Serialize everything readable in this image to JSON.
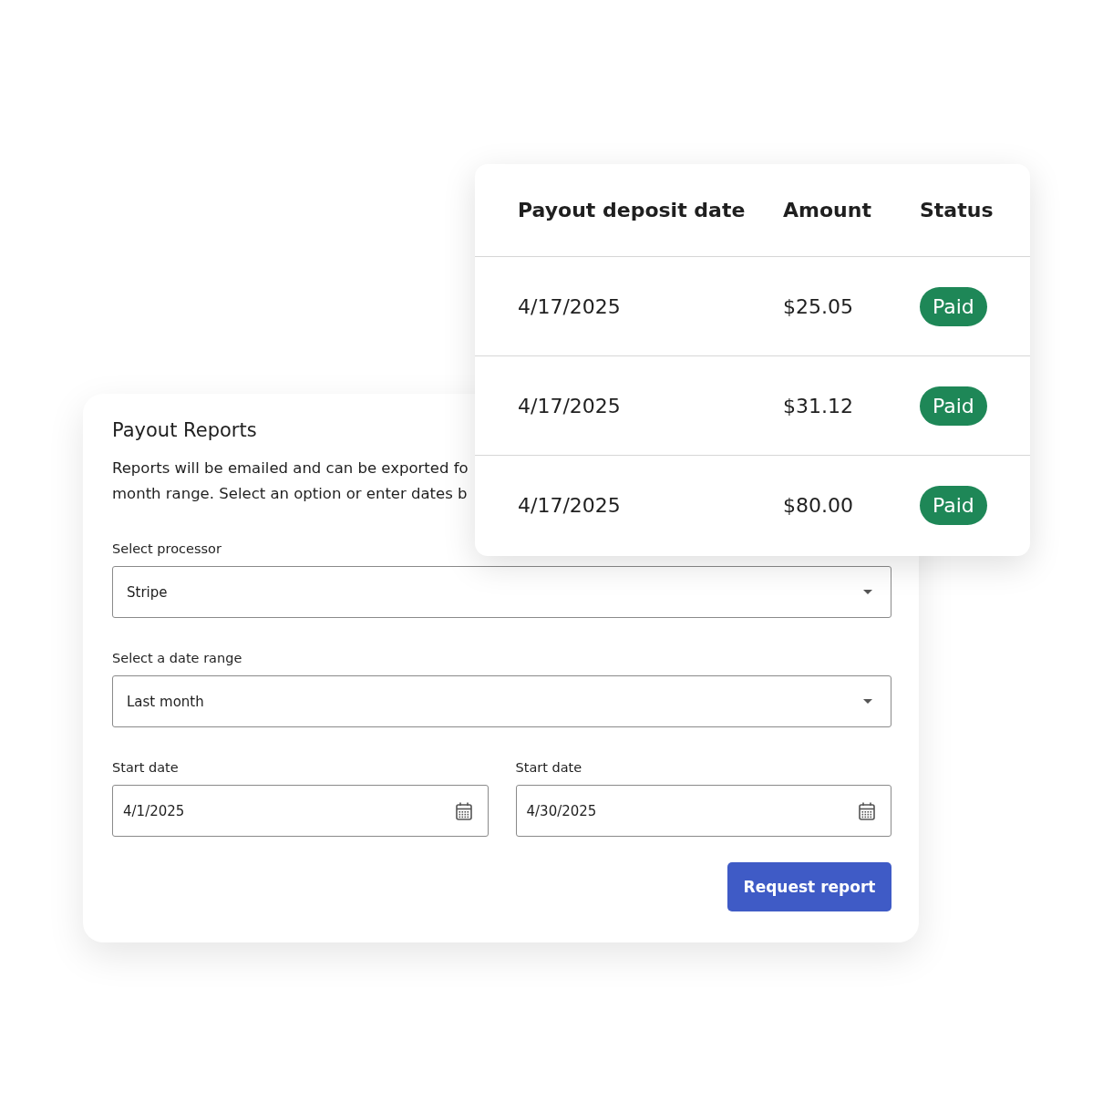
{
  "report_form": {
    "title": "Payout Reports",
    "description_lines": [
      "Reports will be emailed and can be exported fo",
      "month range. Select an option or enter dates b"
    ],
    "selects": [
      {
        "label": "Select processor",
        "value": "Stripe"
      },
      {
        "label": "Select a date range",
        "value": "Last month"
      }
    ],
    "date_fields": [
      {
        "label": "Start date",
        "value": "4/1/2025"
      },
      {
        "label": "Start date",
        "value": "4/30/2025"
      }
    ],
    "button": "Request report"
  },
  "payouts_table": {
    "columns": [
      "Payout deposit date",
      "Amount",
      "Status"
    ],
    "rows": [
      {
        "date": "4/17/2025",
        "amount": "$25.05",
        "status": {
          "label": "Paid",
          "kind": "paid"
        }
      },
      {
        "date": "4/17/2025",
        "amount": "$31.12",
        "status": {
          "label": "Paid",
          "kind": "paid"
        }
      },
      {
        "date": "4/17/2025",
        "amount": "$80.00",
        "status": {
          "label": "Paid",
          "kind": "paid"
        }
      }
    ]
  }
}
